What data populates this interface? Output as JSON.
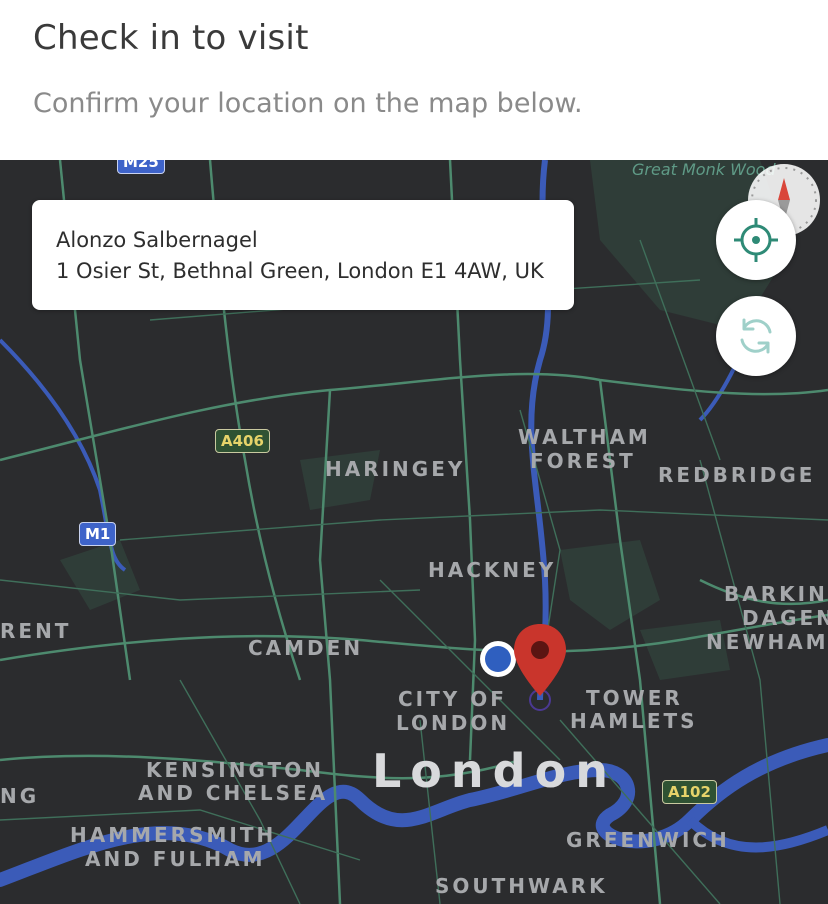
{
  "header": {
    "title": "Check in to visit",
    "subtitle": "Confirm your location on the map below."
  },
  "address_card": {
    "name": "Alonzo Salbernagel",
    "address": "1 Osier St, Bethnal Green, London E1 4AW, UK"
  },
  "map": {
    "areas": {
      "haringey": "HARINGEY",
      "waltham_forest_1": "WALTHAM",
      "waltham_forest_2": "FOREST",
      "redbridge": "REDBRIDGE",
      "hackney": "HACKNEY",
      "barking_1": "BARKING",
      "barking_2": "DAGEN",
      "newham": "NEWHAM",
      "brent": "RENT",
      "camden": "CAMDEN",
      "city_1": "CITY OF",
      "city_2": "LONDON",
      "tower_1": "TOWER",
      "tower_2": "HAMLETS",
      "kensington_1": "KENSINGTON",
      "kensington_2": "AND CHELSEA",
      "ealing": "NG",
      "hammersmith_1": "HAMMERSMITH",
      "hammersmith_2": "AND FULHAM",
      "greenwich": "GREENWICH",
      "southwark": "SOUTHWARK"
    },
    "city": "London",
    "park": "Great Monk Wood",
    "roads": {
      "a406": "A406",
      "m1": "M1",
      "m25": "M25",
      "a102": "A102"
    },
    "colors": {
      "background": "#2b2c2e",
      "water": "#3b5bb8",
      "park": "#2f3d38",
      "roads": "#4d8a6e",
      "pin": "#c9352c",
      "user_dot": "#2f5fbf",
      "button_icon_primary": "#2e8a76",
      "button_icon_secondary": "#9fd0c9"
    },
    "icons": {
      "locate": "crosshair-icon",
      "refresh": "refresh-icon",
      "compass": "compass-icon",
      "pin": "map-pin-icon",
      "user": "user-location-icon"
    }
  }
}
